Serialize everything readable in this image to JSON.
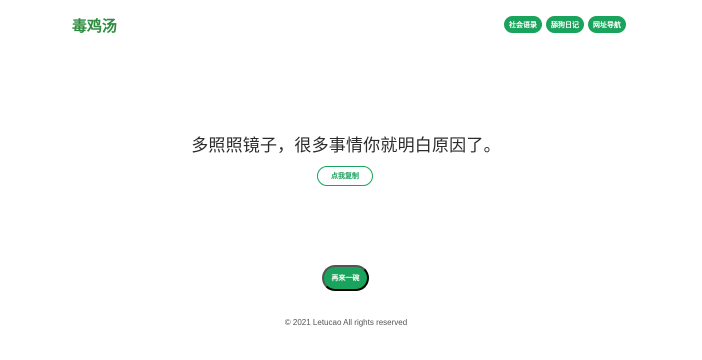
{
  "header": {
    "logo_text": "毒鸡汤",
    "nav": [
      {
        "label": "社会语录"
      },
      {
        "label": "舔狗日记"
      },
      {
        "label": "网址导航"
      }
    ]
  },
  "main": {
    "quote": "多照照镜子，很多事情你就明白原因了。",
    "copy_label": "点我复制",
    "again_label": "再来一碗"
  },
  "footer": {
    "text": "© 2021 Letucao All rights reserved"
  },
  "colors": {
    "accent": "#1aa35c",
    "logo": "#2e8b3f"
  }
}
